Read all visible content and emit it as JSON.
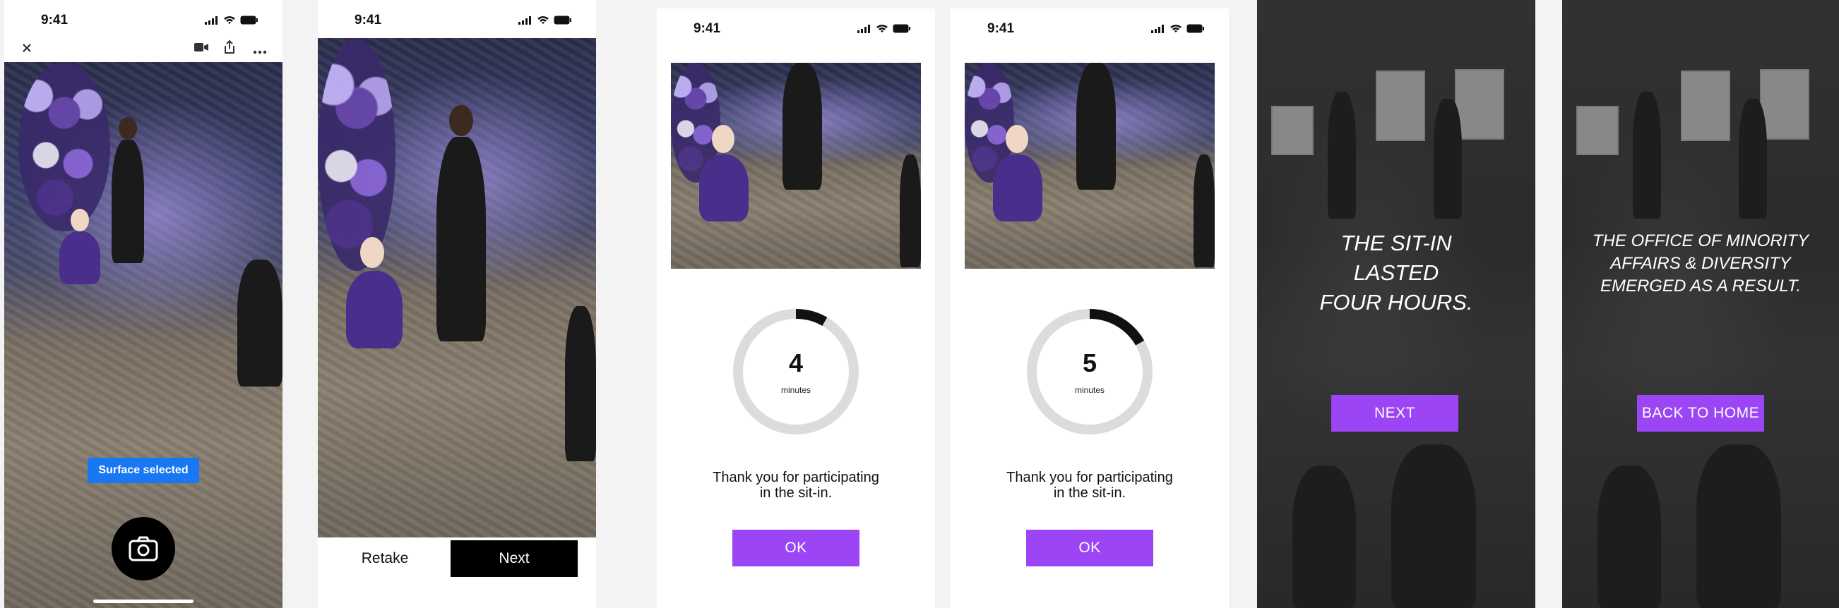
{
  "status": {
    "time": "9:41"
  },
  "screen1": {
    "close_icon": "close-icon",
    "toolbar_icons": [
      "video-icon",
      "share-icon",
      "more-icon"
    ],
    "badge": "Surface selected",
    "shutter_icon": "camera-icon",
    "colors": {
      "badge": "#1877f2"
    }
  },
  "screen2": {
    "retake_label": "Retake",
    "next_label": "Next"
  },
  "screen3": {
    "value": "4",
    "unit": "minutes",
    "progress": 0.083,
    "thanks_line1": "Thank you for participating",
    "thanks_line2": "in the sit-in.",
    "ok_label": "OK"
  },
  "screen4": {
    "value": "5",
    "unit": "minutes",
    "progress": 0.167,
    "thanks_line1": "Thank you for participating",
    "thanks_line2": "in the sit-in.",
    "ok_label": "OK"
  },
  "screen5": {
    "line1": "THE SIT-IN",
    "line2": "LASTED",
    "line3": "FOUR HOURS.",
    "next_label": "NEXT"
  },
  "screen6": {
    "line1": "THE OFFICE OF MINORITY",
    "line2": "AFFAIRS & DIVERSITY",
    "line3": "EMERGED AS A RESULT.",
    "home_label": "BACK TO HOME"
  },
  "colors": {
    "accent": "#9b45f4",
    "ring_track": "#dcdcdc",
    "ring_fill": "#111111"
  }
}
